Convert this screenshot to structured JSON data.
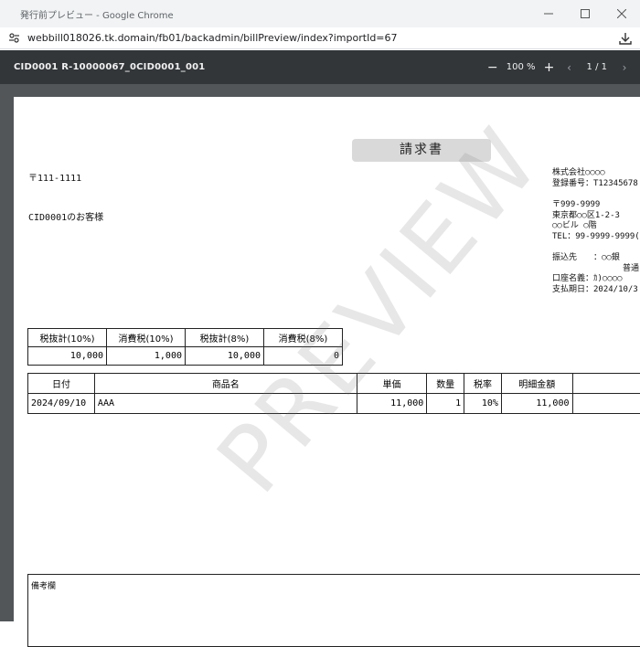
{
  "window": {
    "title": "発行前プレビュー - Google Chrome",
    "url": "webbill018026.tk.domain/fb01/backadmin/billPreview/index?importId=67"
  },
  "pdf_toolbar": {
    "doc_name": "CID0001 R-10000067_0CID0001_001",
    "zoom": "100 %",
    "page_display": "1 / 1"
  },
  "document": {
    "title": "請求書",
    "postal_code": "〒111-1111",
    "customer": "CID0001のお客様",
    "issuer": {
      "company": "株式会社○○○○",
      "registration": "登録番号：T12345678",
      "postal": "〒999-9999",
      "address1": "東京都○○区1-2-3",
      "address2": "○○ビル ○階",
      "tel": "TEL：99-9999-9999(",
      "bank_label": "振込先　　：",
      "bank_name": "○○銀",
      "account_type": "普通",
      "account_name": "口座名義：ｶ)○○○○",
      "due": "支払期日：2024/10/3"
    },
    "tax_summary": {
      "headers": [
        "税抜計(10%)",
        "消費税(10%)",
        "税抜計(8%)",
        "消費税(8%)"
      ],
      "values": [
        "10,000",
        "1,000",
        "10,000",
        "0"
      ]
    },
    "items": {
      "headers": [
        "日付",
        "商品名",
        "単価",
        "数量",
        "税率",
        "明細金額",
        ""
      ],
      "rows": [
        [
          "2024/09/10",
          "AAA",
          "11,000",
          "1",
          "10%",
          "11,000",
          ""
        ]
      ]
    },
    "remarks_label": "備考欄",
    "watermark": "PREVIEW"
  }
}
